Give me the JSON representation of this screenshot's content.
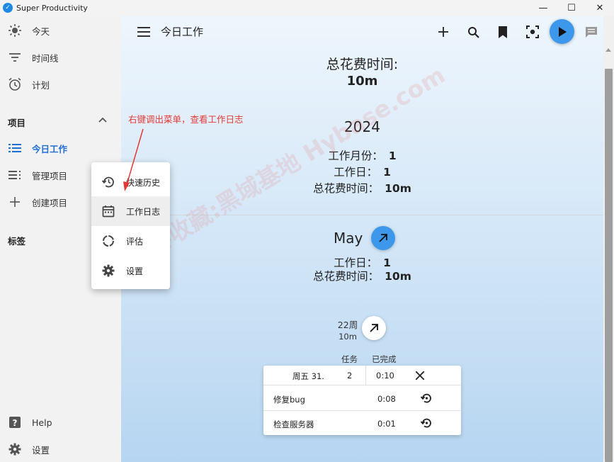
{
  "window": {
    "title": "Super Productivity",
    "controls": {
      "minimize": "—",
      "maximize": "☐",
      "close": "✕"
    }
  },
  "sidebar": {
    "nav": [
      {
        "label": "今天",
        "icon": "sun-icon"
      },
      {
        "label": "时间线",
        "icon": "filter-lines-icon"
      },
      {
        "label": "计划",
        "icon": "alarm-clock-icon"
      }
    ],
    "projects_heading": "项目",
    "projects": [
      {
        "label": "今日工作",
        "icon": "list-icon",
        "active": true
      },
      {
        "label": "管理项目",
        "icon": "manage-list-icon"
      },
      {
        "label": "创建项目",
        "icon": "plus-icon"
      }
    ],
    "tags_heading": "标签",
    "footer": [
      {
        "label": "Help",
        "icon": "help-icon"
      },
      {
        "label": "设置",
        "icon": "gear-icon"
      }
    ]
  },
  "header": {
    "title": "今日工作",
    "actions": [
      "add-icon",
      "search-icon",
      "bookmark-icon",
      "focus-icon",
      "play-icon",
      "comment-icon"
    ]
  },
  "summary": {
    "total_label": "总花费时间:",
    "total_value": "10m",
    "year": "2024",
    "year_stats": [
      {
        "label": "工作月份：",
        "value": "1"
      },
      {
        "label": "工作日：",
        "value": "1"
      },
      {
        "label": "总花费时间：",
        "value": "10m"
      }
    ],
    "month": "May",
    "month_stats": [
      {
        "label": "工作日：",
        "value": "1"
      },
      {
        "label": "总花费时间：",
        "value": "10m"
      }
    ],
    "week_label": "22周",
    "week_time": "10m"
  },
  "day_table": {
    "col_tasks": "任务",
    "col_done": "已完成",
    "day": "周五 31.",
    "task_count": "2",
    "time": "0:10",
    "tasks": [
      {
        "name": "修复bug",
        "time": "0:08"
      },
      {
        "name": "检查服务器",
        "time": "0:01"
      }
    ]
  },
  "context_menu": {
    "items": [
      {
        "label": "快速历史",
        "icon": "history-icon"
      },
      {
        "label": "工作日志",
        "icon": "calendar-icon"
      },
      {
        "label": "评估",
        "icon": "progress-ring-icon"
      },
      {
        "label": "设置",
        "icon": "gear-icon"
      }
    ]
  },
  "annotation": "右键调出菜单，查看工作日志",
  "watermark": "记得收藏:黑域基地 Hybase.com",
  "colors": {
    "accent": "#3d97ea",
    "active": "#1e6fd9",
    "annotation": "#e53935"
  }
}
